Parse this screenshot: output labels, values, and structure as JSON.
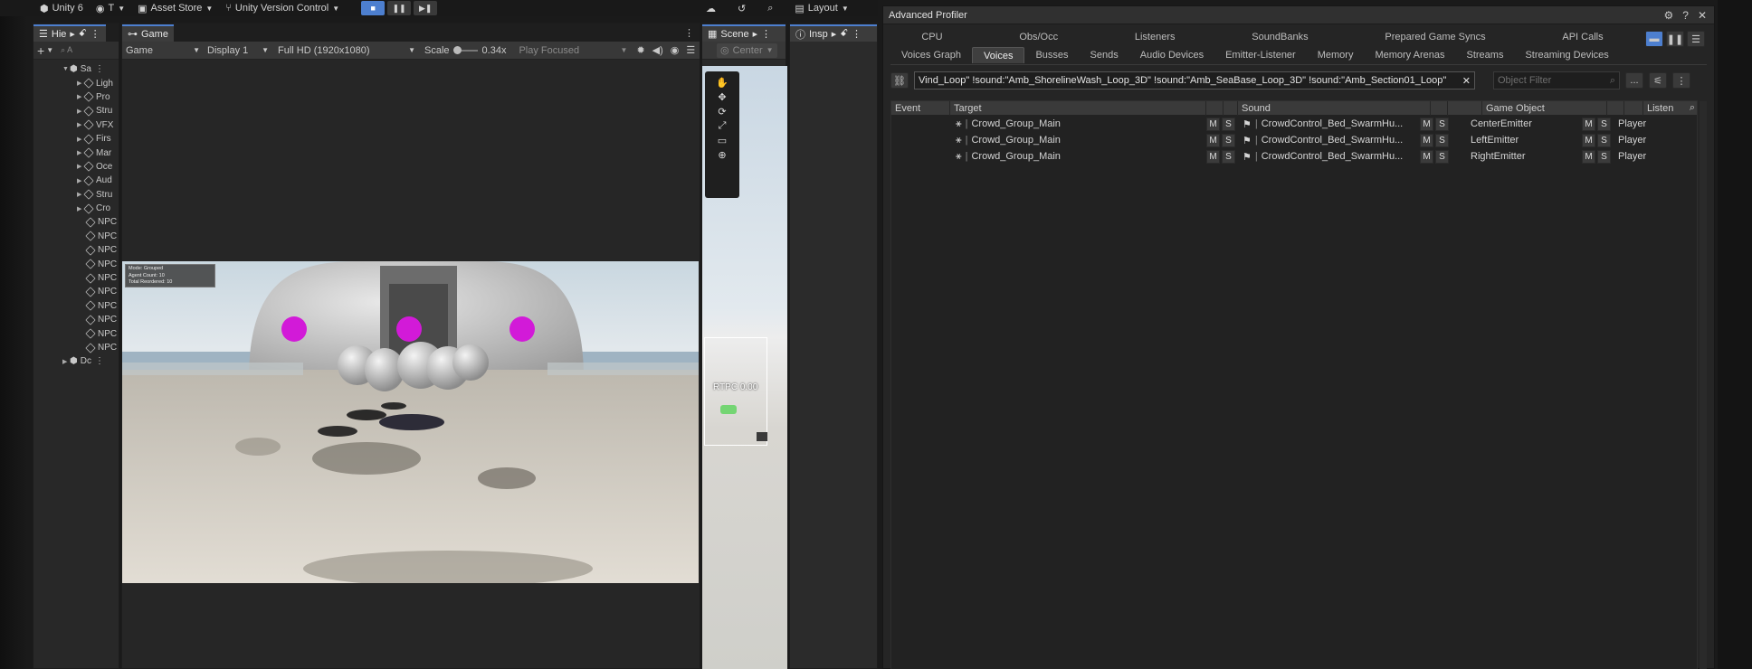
{
  "topbar": {
    "account": "Unity 6",
    "user": "T",
    "asset_store": "Asset Store",
    "version_control": "Unity Version Control",
    "layout": "Layout"
  },
  "hierarchy": {
    "tab": "Hie",
    "search_placeholder": "A",
    "scene_root": "Sa",
    "items": [
      "Ligh",
      "Pro",
      "Stru",
      "VFX",
      "Firs",
      "Mar",
      "Oce",
      "Aud",
      "Stru",
      "Cro",
      "NPC",
      "NPC",
      "NPC",
      "NPC",
      "NPC",
      "NPC",
      "NPC",
      "NPC",
      "NPC",
      "NPC"
    ],
    "footer_item": "Dc"
  },
  "game": {
    "tab": "Game",
    "mode": "Game",
    "display": "Display 1",
    "resolution": "Full HD (1920x1080)",
    "scale_label": "Scale",
    "scale_value": "0.34x",
    "play_focused": "Play Focused",
    "overlay_lines": [
      "Mode: Grouped",
      "Agent Count: 10",
      "Total Reordered: 10"
    ]
  },
  "scene": {
    "tab": "Scene",
    "pivot": "Center",
    "label": "RTPC 0.00"
  },
  "inspector": {
    "tab": "Insp"
  },
  "profiler": {
    "title": "Advanced Profiler",
    "tabs_row1": [
      "CPU",
      "Obs/Occ",
      "Listeners",
      "SoundBanks",
      "Prepared Game Syncs",
      "API Calls"
    ],
    "tabs_row2": [
      "Voices Graph",
      "Voices",
      "Busses",
      "Sends",
      "Audio Devices",
      "Emitter-Listener",
      "Memory",
      "Memory Arenas",
      "Streams",
      "Streaming Devices"
    ],
    "selected_tab": "Voices",
    "filter_text": "Vind_Loop\" !sound:\"Amb_ShorelineWash_Loop_3D\" !sound:\"Amb_SeaBase_Loop_3D\" !sound:\"Amb_Section01_Loop\"",
    "object_filter_placeholder": "Object Filter",
    "more_button": "...",
    "columns": {
      "event": "Event",
      "target": "Target",
      "sound": "Sound",
      "game_object": "Game Object",
      "listener": "Listen"
    },
    "mute_label": "M",
    "solo_label": "S",
    "rows": [
      {
        "target": "Crowd_Group_Main",
        "sound": "CrowdControl_Bed_SwarmHu...",
        "game_object": "CenterEmitter",
        "listener": "Player"
      },
      {
        "target": "Crowd_Group_Main",
        "sound": "CrowdControl_Bed_SwarmHu...",
        "game_object": "LeftEmitter",
        "listener": "Player"
      },
      {
        "target": "Crowd_Group_Main",
        "sound": "CrowdControl_Bed_SwarmHu...",
        "game_object": "RightEmitter",
        "listener": "Player"
      }
    ]
  }
}
